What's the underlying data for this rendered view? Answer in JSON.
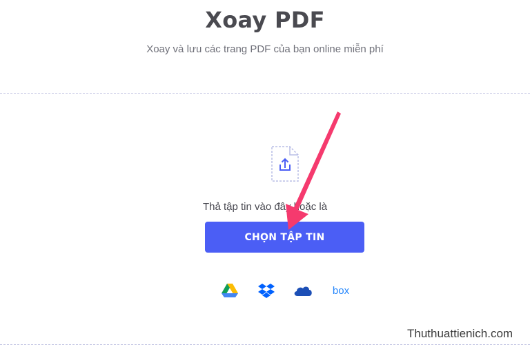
{
  "header": {
    "title": "Xoay PDF",
    "subtitle": "Xoay và lưu các trang PDF của bạn online miễn phí"
  },
  "upload": {
    "drop_text": "Thả tập tin vào đây hoặc là",
    "choose_button": "CHỌN TẬP TIN",
    "icon": "file-upload-icon"
  },
  "cloud_sources": [
    {
      "name": "Google Drive",
      "icon": "google-drive-icon"
    },
    {
      "name": "Dropbox",
      "icon": "dropbox-icon"
    },
    {
      "name": "OneDrive",
      "icon": "onedrive-icon"
    },
    {
      "name": "Box",
      "icon": "box-icon",
      "label": "box"
    }
  ],
  "watermark": "Thuthuattienich.com",
  "colors": {
    "primary_button": "#4b5ef5",
    "annotation_arrow": "#f53a6e",
    "divider": "#c9cbe6"
  }
}
